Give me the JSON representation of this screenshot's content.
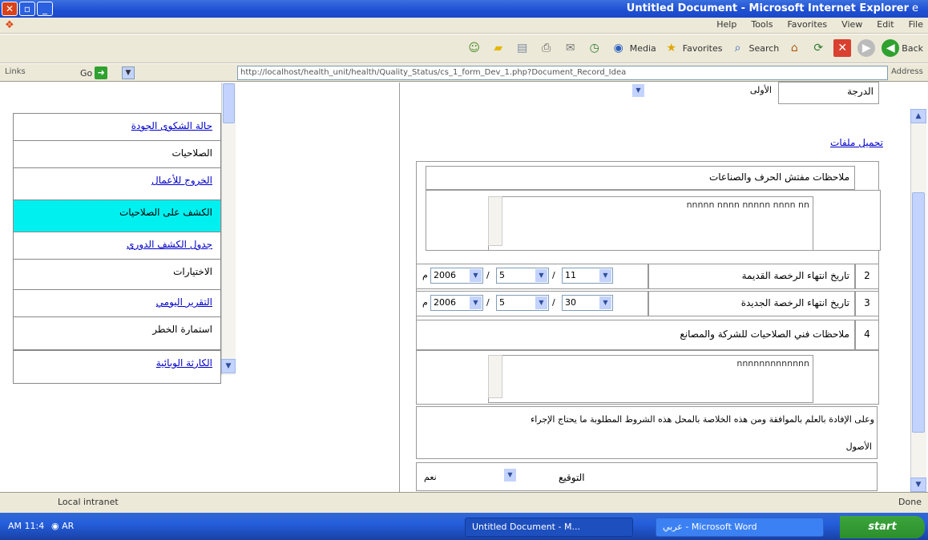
{
  "window": {
    "title": "Untitled Document - Microsoft Internet Explorer",
    "close_glyph": "✕",
    "max_glyph": "▫",
    "min_glyph": "_"
  },
  "menu": [
    "Help",
    "Tools",
    "Favorites",
    "View",
    "Edit",
    "File"
  ],
  "toolbar": {
    "back": "Back",
    "search": "Search",
    "favorites": "Favorites",
    "media": "Media"
  },
  "address": {
    "links": "Links",
    "go": "Go",
    "url": "http://localhost/health_unit/health/Quality_Status/cs_1_form_Dev_1.php?Document_Record_Idea",
    "label": "Address"
  },
  "nav": {
    "items": [
      {
        "label": "حالة الشكوى الجودة",
        "style": "link"
      },
      {
        "label": "الصلاحيات",
        "style": "plain"
      },
      {
        "label": "الخروج للأعمال",
        "style": "link"
      },
      {
        "label": "الكشف على الصلاحيات",
        "style": "active"
      },
      {
        "label": "جدول الكشف الدوري",
        "style": "link"
      },
      {
        "label": "الاختيارات",
        "style": "plain"
      },
      {
        "label": "التقرير اليومي",
        "style": "link"
      },
      {
        "label": "استمارة الخطر",
        "style": "plain"
      },
      {
        "label": "الكارثة الوبائية",
        "style": "link"
      }
    ]
  },
  "form": {
    "row1": {
      "label": "الدرجة",
      "value": "الأولى"
    },
    "upload_link": "تحميل ملفات",
    "notes_heading": "ملاحظات مفتش الحرف والصناعات",
    "notes_text": "nnnnn nnnn nnnnn nnnn nn",
    "row2": {
      "num": "2",
      "label": "تاريخ انتهاء الرخصة القديمة",
      "day": "11",
      "month": "5",
      "year": "2006",
      "suffix": "م"
    },
    "row3": {
      "num": "3",
      "label": "تاريخ انتهاء الرخصة الجديدة",
      "day": "30",
      "month": "5",
      "year": "2006",
      "suffix": "م"
    },
    "row4": {
      "num": "4",
      "label": "ملاحظات فني الصلاحيات للشركة والمصانع"
    },
    "note2_text": "nnnnnnnnnnnnn",
    "footer_text": "وعلى الإفادة بالعلم بالموافقة ومن هذه الخلاصة بالمحل هذه الشروط المطلوبة ما يحتاج الإجراء",
    "footer_text2": "الأصول",
    "signature_label": "التوقيع",
    "signature_value": "نعم"
  },
  "status": {
    "zone": "Local intranet",
    "done": "Done"
  },
  "taskbar": {
    "clock": "AM 11:4",
    "tray": "AR",
    "task1": "Untitled Document - M...",
    "task2": "عربي - Microsoft Word",
    "start": "start"
  },
  "colors": {
    "active_nav": "#00f0f0",
    "link": "#0000cc",
    "title_bar": "#1f4fd2"
  }
}
